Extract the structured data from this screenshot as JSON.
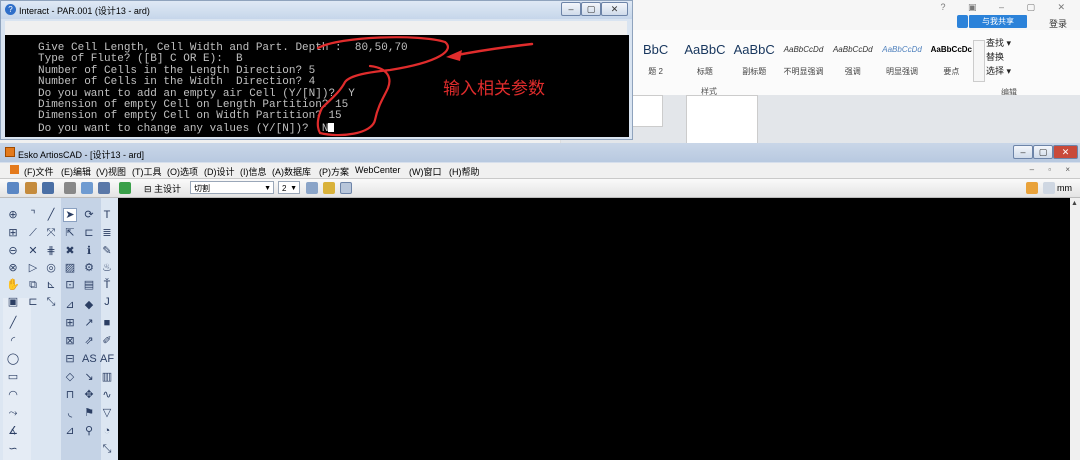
{
  "interact": {
    "title": "Interact - PAR.001 (设计13 - ard)",
    "console_lines": [
      "Give Cell Length, Cell Width and Part. Depth :  80,50,70",
      "Type of Flute? ([B] C OR E):  B",
      "Number of Cells in the Length Direction? 5",
      "Number of Cells in the Width  Direction? 4",
      "Do you want to add an empty air Cell (Y/[N])?  Y",
      "Dimension of empty Cell on Length Partition? 15",
      "Dimension of empty Cell on Width Partition? 15",
      "Do you want to change any values (Y/[N])?  N"
    ],
    "annotation": "输入相关参数",
    "annotation_color": "#e02c2c"
  },
  "word": {
    "share_label": "与我共享",
    "login_label": "登录",
    "styles": [
      {
        "sample": "BbC",
        "name": "题 2"
      },
      {
        "sample": "AaBbC",
        "name": "标题"
      },
      {
        "sample": "AaBbC",
        "name": "副标题"
      },
      {
        "sample": "AaBbCcDd",
        "name": "不明显强调"
      },
      {
        "sample": "AaBbCcDd",
        "name": "强调"
      },
      {
        "sample": "AaBbCcDd",
        "name": "明显强调"
      },
      {
        "sample": "AaBbCcDc",
        "name": "要点"
      }
    ],
    "styles_group": "样式",
    "edit_items": [
      "查找 ▾",
      "替换",
      "选择 ▾"
    ],
    "edit_group": "编辑"
  },
  "cad": {
    "title": "Esko ArtiosCAD - [设计13 - ard]",
    "menu": [
      "(F)文件",
      "(E)编辑",
      "(V)视图",
      "(T)工具",
      "(O)选项",
      "(D)设计",
      "(I)信息",
      "(A)数据库",
      "(P)方案",
      "WebCenter",
      "(W)窗口",
      "(H)帮助"
    ],
    "layer_label": "主设计",
    "layer_combo": "切割",
    "number_combo": "2",
    "unit": "mm",
    "brand_color": "#e47a1c"
  }
}
